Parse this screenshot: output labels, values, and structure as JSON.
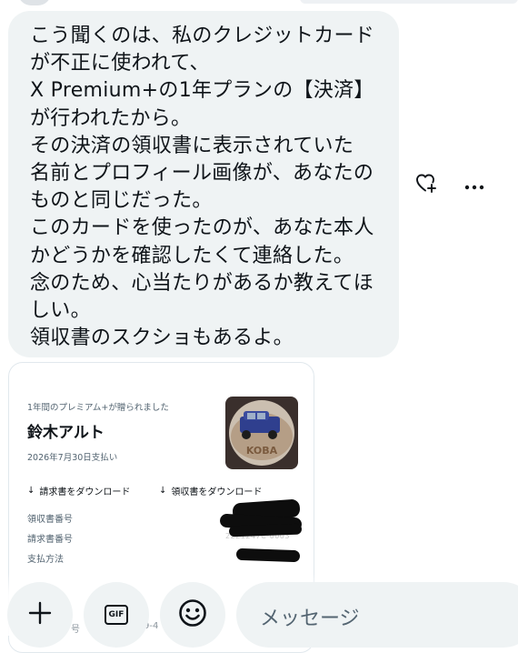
{
  "message": {
    "text": "こう聞くのは、私のクレジットカード\nが不正に使われて、\nX Premium+の1年プランの【決済】\nが行われたから。\nその決済の領収書に表示されていた\n名前とプロフィール画像が、あなたの\nものと同じだった。\nこのカードを使ったのが、あなた本人\nかどうかを確認したくて連絡した。\n念のため、心当たりがあるか教えてほ\nしい。\n領収書のスクショもあるよ。"
  },
  "actions": {
    "react_icon": "heart-plus-icon",
    "more_icon": "more-horizontal-icon"
  },
  "receipt": {
    "subtitle": "1年間のプレミアム+が贈られました",
    "name": "鈴木アルト",
    "payment_date": "2026年7月30日支払い",
    "thumbnail_text": "KOBA",
    "download_invoice": "請求書をダウンロード",
    "download_receipt": "領収書をダウンロード",
    "fields": [
      {
        "label": "領収書番号"
      },
      {
        "label": "請求書番号",
        "partial_value": "2221247C-0003"
      },
      {
        "label": "支払方法"
      }
    ],
    "partial_footer_label": "号",
    "partial_footer_value": "9-4"
  },
  "composer": {
    "add_icon": "plus-icon",
    "gif_label": "GIF",
    "emoji_icon": "emoji-icon",
    "placeholder": "メッセージ"
  },
  "colors": {
    "bubble_bg": "#eff3f4",
    "text": "#0f1419",
    "secondary_text": "#536471",
    "border": "#e1e8ed"
  }
}
